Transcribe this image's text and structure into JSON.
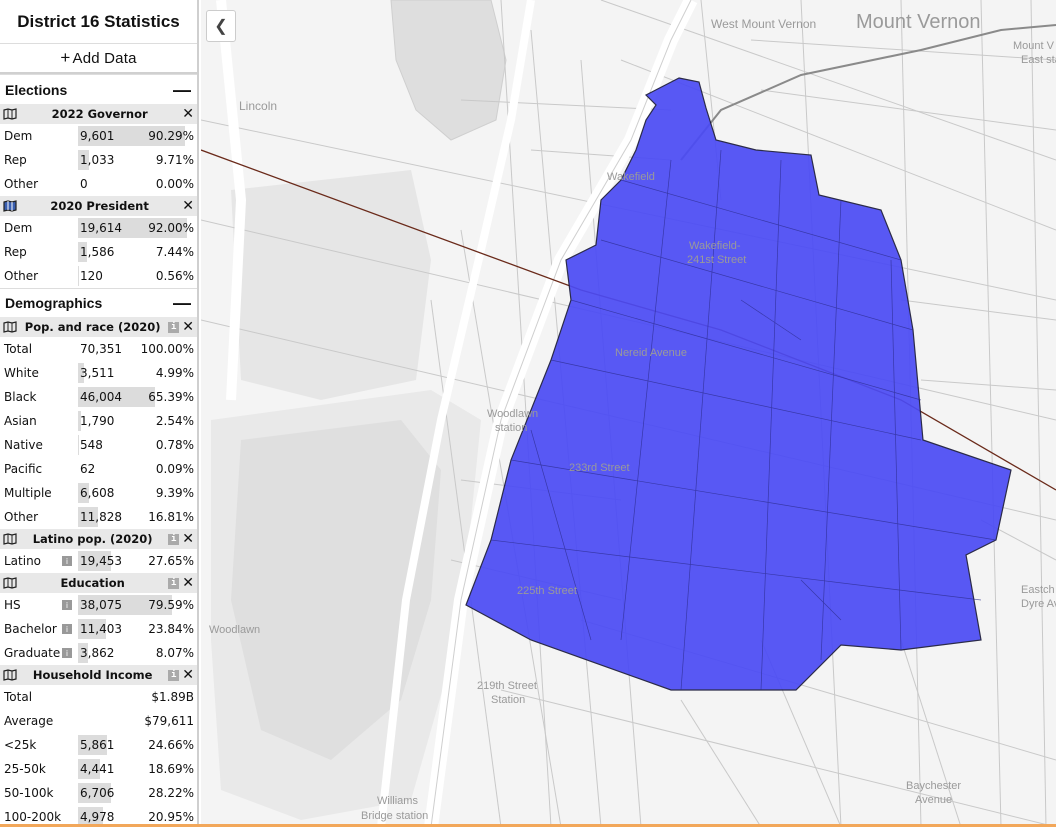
{
  "sidebar": {
    "title": "District 16 Statistics",
    "add_data": "Add Data",
    "elections": {
      "label": "Elections",
      "datasets": [
        {
          "name": "2022 Governor",
          "active": false,
          "rows": [
            {
              "label": "Dem",
              "value": "9,601",
              "pct": "90.29%",
              "share": 0.9029
            },
            {
              "label": "Rep",
              "value": "1,033",
              "pct": "9.71%",
              "share": 0.0971
            },
            {
              "label": "Other",
              "value": "0",
              "pct": "0.00%",
              "share": 0
            }
          ]
        },
        {
          "name": "2020 President",
          "active": true,
          "rows": [
            {
              "label": "Dem",
              "value": "19,614",
              "pct": "92.00%",
              "share": 0.92
            },
            {
              "label": "Rep",
              "value": "1,586",
              "pct": "7.44%",
              "share": 0.0744
            },
            {
              "label": "Other",
              "value": "120",
              "pct": "0.56%",
              "share": 0.0056
            }
          ]
        }
      ]
    },
    "demographics": {
      "label": "Demographics",
      "datasets": [
        {
          "name": "Pop. and race (2020)",
          "rows": [
            {
              "label": "Total",
              "value": "70,351",
              "pct": "100.00%",
              "share": 0
            },
            {
              "label": "White",
              "value": "3,511",
              "pct": "4.99%",
              "share": 0.0499
            },
            {
              "label": "Black",
              "value": "46,004",
              "pct": "65.39%",
              "share": 0.6539
            },
            {
              "label": "Asian",
              "value": "1,790",
              "pct": "2.54%",
              "share": 0.0254
            },
            {
              "label": "Native",
              "value": "548",
              "pct": "0.78%",
              "share": 0.0078
            },
            {
              "label": "Pacific",
              "value": "62",
              "pct": "0.09%",
              "share": 0.0009
            },
            {
              "label": "Multiple",
              "value": "6,608",
              "pct": "9.39%",
              "share": 0.0939
            },
            {
              "label": "Other",
              "value": "11,828",
              "pct": "16.81%",
              "share": 0.1681
            }
          ]
        },
        {
          "name": "Latino pop. (2020)",
          "rows": [
            {
              "label": "Latino",
              "value": "19,453",
              "pct": "27.65%",
              "share": 0.2765,
              "info": true
            }
          ]
        },
        {
          "name": "Education",
          "rows": [
            {
              "label": "HS",
              "value": "38,075",
              "pct": "79.59%",
              "share": 0.7959,
              "info": true
            },
            {
              "label": "Bachelor",
              "value": "11,403",
              "pct": "23.84%",
              "share": 0.2384,
              "info": true
            },
            {
              "label": "Graduate",
              "value": "3,862",
              "pct": "8.07%",
              "share": 0.0807,
              "info": true
            }
          ]
        },
        {
          "name": "Household Income",
          "rows": [
            {
              "label": "Total",
              "value": "",
              "pct": "$1.89B",
              "share": 0
            },
            {
              "label": "Average",
              "value": "",
              "pct": "$79,611",
              "share": 0
            },
            {
              "label": "<25k",
              "value": "5,861",
              "pct": "24.66%",
              "share": 0.2466
            },
            {
              "label": "25-50k",
              "value": "4,441",
              "pct": "18.69%",
              "share": 0.1869
            },
            {
              "label": "50-100k",
              "value": "6,706",
              "pct": "28.22%",
              "share": 0.2822
            },
            {
              "label": "100-200k",
              "value": "4,978",
              "pct": "20.95%",
              "share": 0.2095
            }
          ]
        }
      ]
    }
  },
  "map": {
    "labels": {
      "mount_vernon": "Mount Vernon",
      "west_mount_vernon": "West Mount Vernon",
      "mount_vernon_east_1": "Mount V",
      "mount_vernon_east_2": "East sta",
      "lincoln": "Lincoln",
      "wakefield": "Wakefield",
      "wakefield_241_1": "Wakefield-",
      "wakefield_241_2": "241st Street",
      "nereid": "Nereid Avenue",
      "woodlawn_station_1": "Woodlawn",
      "woodlawn_station_2": "station",
      "street_233": "233rd Street",
      "street_225": "225th Street",
      "woodlawn": "Woodlawn",
      "street_219_1": "219th Street",
      "street_219_2": "Station",
      "williams_1": "Williams",
      "williams_2": "Bridge station",
      "baychester_1": "Baychester",
      "baychester_2": "Avenue",
      "eastch_1": "Eastch",
      "eastch_2": "Dyre Av"
    },
    "district_fill": "#4b4bf5",
    "district_stroke": "#1a1a3a"
  }
}
